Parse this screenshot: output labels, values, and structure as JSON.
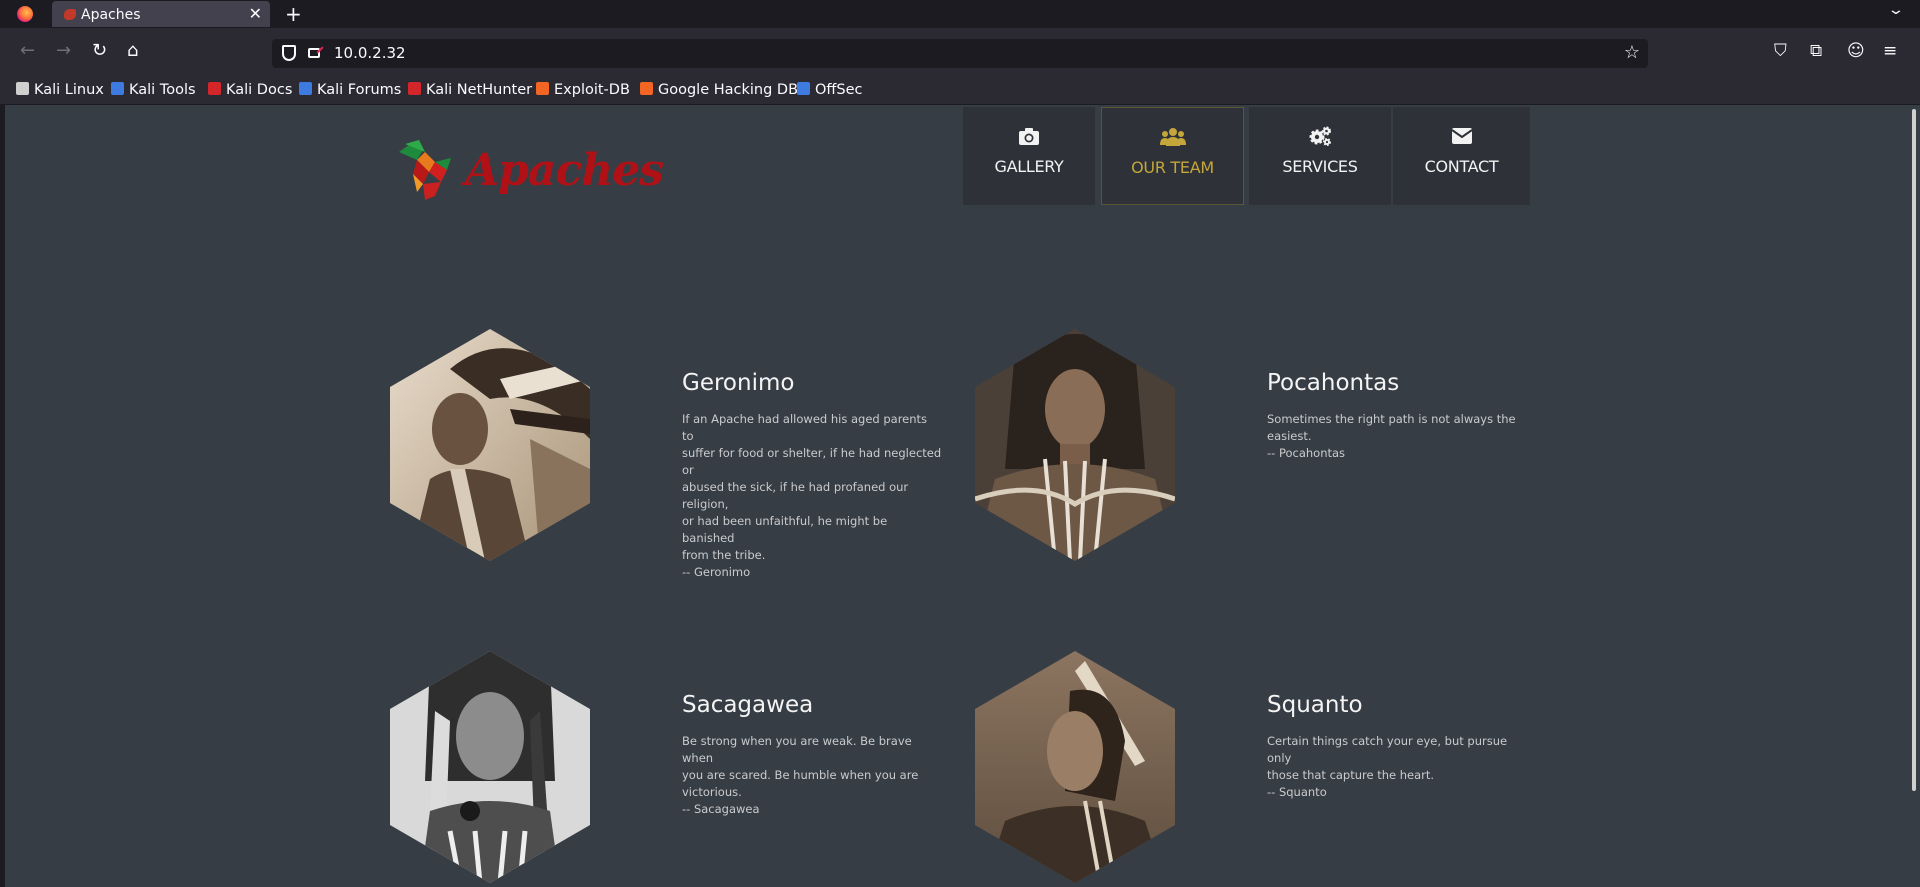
{
  "browser": {
    "tab_title": "Apaches",
    "tab_close": "✕",
    "new_tab": "+",
    "url": "10.0.2.32",
    "bookmarks": [
      {
        "label": "Kali Linux",
        "icon": "kali-dragon-icon",
        "color": "#cfcfcf"
      },
      {
        "label": "Kali Tools",
        "icon": "kali-tools-icon",
        "color": "#3d7be0"
      },
      {
        "label": "Kali Docs",
        "icon": "kali-docs-icon",
        "color": "#d2262b"
      },
      {
        "label": "Kali Forums",
        "icon": "kali-forums-icon",
        "color": "#3d7be0"
      },
      {
        "label": "Kali NetHunter",
        "icon": "kali-nethunter-icon",
        "color": "#d2262b"
      },
      {
        "label": "Exploit-DB",
        "icon": "exploit-db-icon",
        "color": "#f26522"
      },
      {
        "label": "Google Hacking DB",
        "icon": "ghdb-icon",
        "color": "#f26522"
      },
      {
        "label": "OffSec",
        "icon": "offsec-icon",
        "color": "#3d7be0"
      }
    ]
  },
  "site": {
    "logo_text": "Apaches",
    "nav": [
      {
        "label": "GALLERY",
        "icon": "camera-icon",
        "active": false
      },
      {
        "label": "OUR TEAM",
        "icon": "group-icon",
        "active": true
      },
      {
        "label": "SERVICES",
        "icon": "gears-icon",
        "active": false
      },
      {
        "label": "CONTACT",
        "icon": "envelope-icon",
        "active": false
      }
    ],
    "accent_color": "#c4a63a",
    "brand_color": "#b01116",
    "team": [
      {
        "name": "Geronimo",
        "quote_lines": [
          "If an Apache had allowed his aged parents to",
          "suffer for food or shelter, if he had neglected or",
          "abused the sick, if he had profaned our religion,",
          "or had been unfaithful, he might be banished",
          "from the tribe."
        ],
        "attribution": "-- Geronimo"
      },
      {
        "name": "Pocahontas",
        "quote_lines": [
          "Sometimes the right path is not always the",
          "easiest."
        ],
        "attribution": "-- Pocahontas"
      },
      {
        "name": "Sacagawea",
        "quote_lines": [
          "Be strong when you are weak. Be brave when",
          "you are scared. Be humble when you are",
          "victorious."
        ],
        "attribution": "-- Sacagawea"
      },
      {
        "name": "Squanto",
        "quote_lines": [
          "Certain things catch your eye, but pursue only",
          "those that capture the heart."
        ],
        "attribution": "-- Squanto"
      }
    ]
  }
}
